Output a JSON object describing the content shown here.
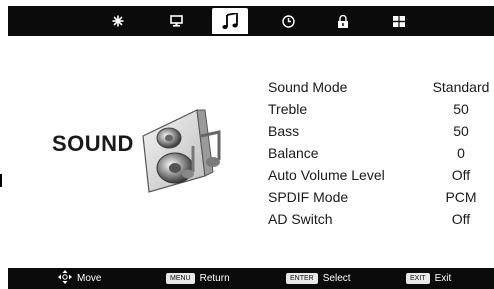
{
  "menu": {
    "title": "SOUND",
    "tabs": [
      {
        "name": "picture",
        "icon": "snowflake-icon",
        "active": false
      },
      {
        "name": "screen",
        "icon": "monitor-icon",
        "active": false
      },
      {
        "name": "sound",
        "icon": "music-note-icon",
        "active": true
      },
      {
        "name": "time",
        "icon": "clock-icon",
        "active": false
      },
      {
        "name": "lock",
        "icon": "lock-icon",
        "active": false
      },
      {
        "name": "setup",
        "icon": "grid-icon",
        "active": false
      }
    ],
    "settings": [
      {
        "label": "Sound Mode",
        "value": "Standard"
      },
      {
        "label": "Treble",
        "value": "50"
      },
      {
        "label": "Bass",
        "value": "50"
      },
      {
        "label": "Balance",
        "value": "0"
      },
      {
        "label": "Auto Volume Level",
        "value": "Off"
      },
      {
        "label": "SPDIF Mode",
        "value": "PCM"
      },
      {
        "label": "AD Switch",
        "value": "Off"
      }
    ]
  },
  "footer": {
    "move_label": "Move",
    "menu_key": "MENU",
    "return_label": "Return",
    "enter_key": "ENTER",
    "select_label": "Select",
    "exit_key": "EXIT",
    "exit_label": "Exit"
  },
  "colors": {
    "bar": "#0b0b0b",
    "background": "#ffffff",
    "text": "#1a1a1a"
  }
}
